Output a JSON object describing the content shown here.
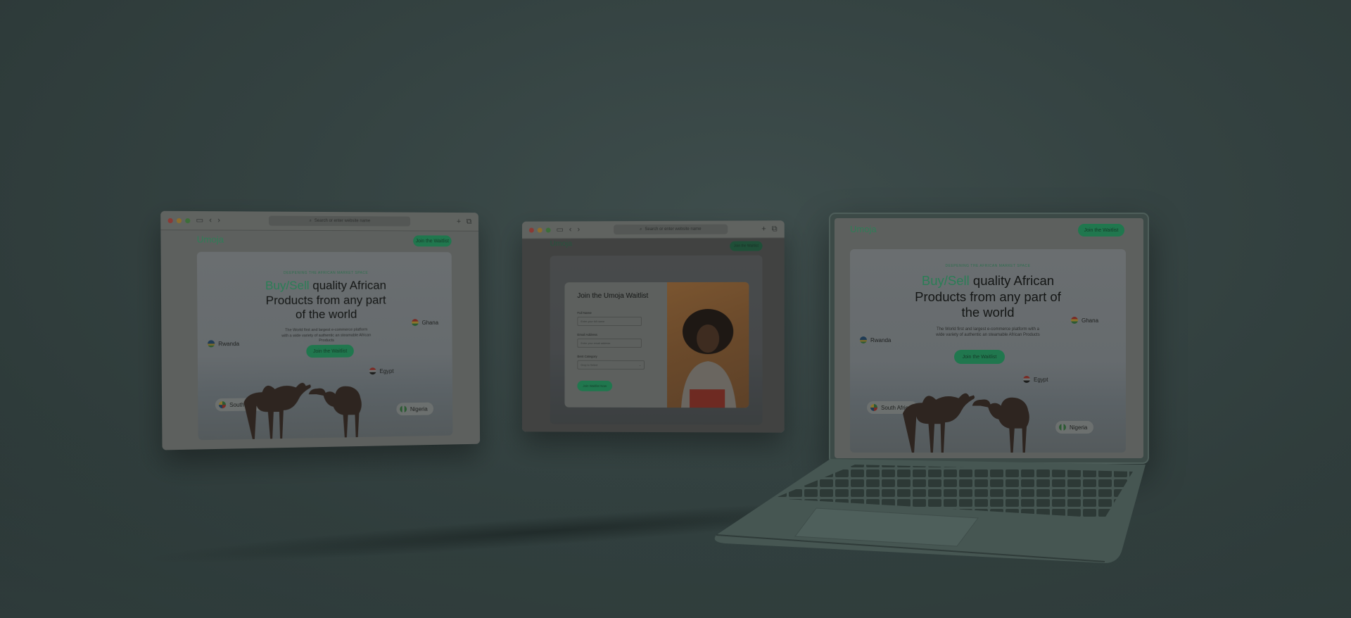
{
  "brand": "Umoja",
  "cta_button": "Join the Waitlist",
  "hero": {
    "eyebrow": "DEEPENING THE AFRICAN MARKET SPACE",
    "headline_accent": "Buy/Sell",
    "headline_rest": "quality African Products from any part of the world",
    "subtext": "The World first and largest e-commerce platform with a wide variety of authentic an steamable African Products",
    "button": "Join the Waitlist"
  },
  "countries": [
    "Rwanda",
    "Ghana",
    "Egypt",
    "South Africa",
    "Nigeria"
  ],
  "browser": {
    "address_placeholder": "Search or enter website name"
  },
  "waitlist_modal": {
    "title": "Join the Umoja Waitlist",
    "fields": [
      {
        "label": "Full Name",
        "placeholder": "Enter your full name"
      },
      {
        "label": "Email Address",
        "placeholder": "Enter your email address"
      },
      {
        "label": "Best Category",
        "placeholder": "Drop to Select"
      }
    ],
    "submit": "Join Waitlist Now"
  },
  "colors": {
    "accent": "#20774e",
    "background": "#344241"
  }
}
